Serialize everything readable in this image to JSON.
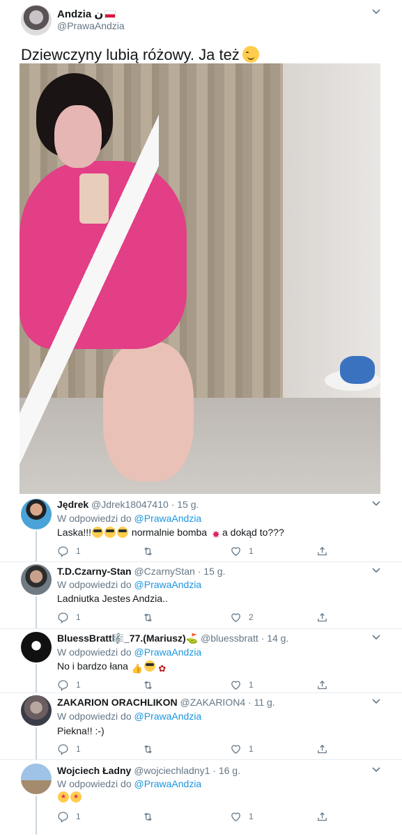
{
  "tweet": {
    "author_name": "Andzia",
    "author_suffix": "ن",
    "author_handle": "@PrawaAndzia",
    "text": "Dziewczyny lubią różowy. Ja też"
  },
  "replies": [
    {
      "name": "Jędrek",
      "handle": "@Jdrek18047410",
      "time": "15 g.",
      "in_reply_prefix": "W odpowiedzi do",
      "in_reply_to": "@PrawaAndzia",
      "text_a": "Laska!!!",
      "text_b": "normalnie bomba",
      "text_c": "a dokąd to???",
      "reply_count": "1",
      "retweet_count": "",
      "like_count": "1"
    },
    {
      "name": "T.D.Czarny-Stan",
      "handle": "@CzarnyStan",
      "time": "15 g.",
      "in_reply_prefix": "W odpowiedzi do",
      "in_reply_to": "@PrawaAndzia",
      "text": "Ladniutka Jestes Andzia..",
      "reply_count": "1",
      "retweet_count": "",
      "like_count": "2"
    },
    {
      "name": "BluessBratt🎼_77.(Mariusz)⛳",
      "handle": "@bluessbratt",
      "time": "14 g.",
      "in_reply_prefix": "W odpowiedzi do",
      "in_reply_to": "@PrawaAndzia",
      "text": "No i bardzo łana",
      "reply_count": "1",
      "retweet_count": "",
      "like_count": "1"
    },
    {
      "name": "ZAKARION ORACHLIKON",
      "handle": "@ZAKARION4",
      "time": "11 g.",
      "in_reply_prefix": "W odpowiedzi do",
      "in_reply_to": "@PrawaAndzia",
      "text": "Piekna!! :-)",
      "reply_count": "1",
      "retweet_count": "",
      "like_count": "1"
    },
    {
      "name": "Wojciech Ładny",
      "handle": "@wojciechladny1",
      "time": "16 g.",
      "in_reply_prefix": "W odpowiedzi do",
      "in_reply_to": "@PrawaAndzia",
      "text": "",
      "reply_count": "1",
      "retweet_count": "",
      "like_count": "1"
    }
  ],
  "separator": "·",
  "colors": {
    "link": "#1b95e0",
    "muted": "#657786",
    "text": "#14171a"
  }
}
